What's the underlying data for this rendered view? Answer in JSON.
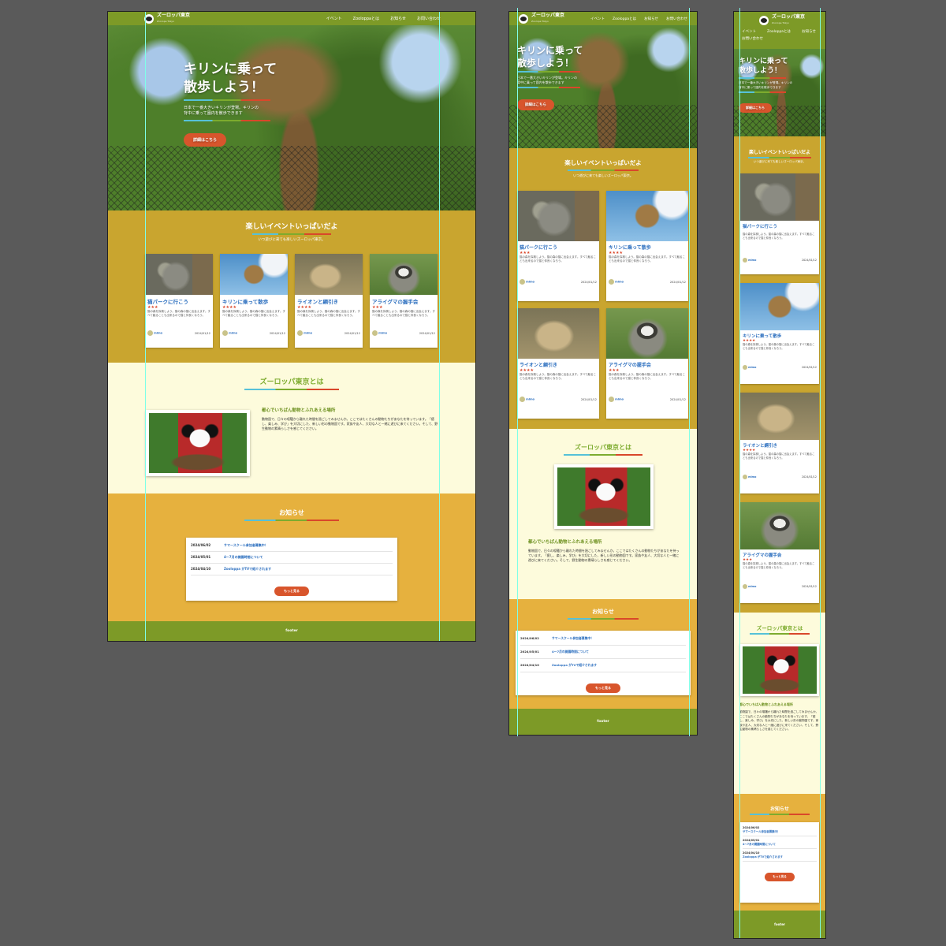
{
  "site": {
    "logo_text": "ズーロッパ東京",
    "logo_sub": "Zoorope Tokyo",
    "nav": [
      "イベント",
      "Zooloppaとは",
      "お知らせ",
      "お問い合わせ"
    ]
  },
  "hero": {
    "title_line1": "キリンに乗って",
    "title_line2": "散歩しよう！",
    "text_line1": "日本で一番大きいキリンが登場。キリンの",
    "text_line2": "背中に乗って園内を散歩できます",
    "button": "詳細はこちら"
  },
  "events": {
    "title": "楽しいイベントいっぱいだよ",
    "subtitle": "いつ遊びに来ても楽しいズーロッパ東京。",
    "cards": [
      {
        "title": "猫パークに行こう",
        "stars": "★★★",
        "rating": 3,
        "text": "猫の森を探検しよう。猫の森の猫に出会えます。すべて触ることも出来るので猫と仲良くなろう。",
        "author": "mimo",
        "date": "2024/01/12",
        "image": "wildcat"
      },
      {
        "title": "キリンに乗って散歩",
        "stars": "★★★★",
        "rating": 4,
        "text": "猫の森を探検しよう。猫の森の猫に出会えます。すべて触ることも出来るので猫と仲良くなろう。",
        "author": "mimo",
        "date": "2024/01/12",
        "image": "giraffe"
      },
      {
        "title": "ライオンと綱引き",
        "stars": "★★★★",
        "rating": 4,
        "text": "猫の森を探検しよう。猫の森の猫に出会えます。すべて触ることも出来るので猫と仲良くなろう。",
        "author": "mimo",
        "date": "2024/01/12",
        "image": "lion"
      },
      {
        "title": "アライグマの握手会",
        "stars": "★★★",
        "rating": 3,
        "text": "猫の森を探検しよう。猫の森の猫に出会えます。すべて触ることも出来るので猫と仲良くなろう。",
        "author": "mimo",
        "date": "2024/01/12",
        "image": "raccoon"
      }
    ]
  },
  "about": {
    "title": "ズーロッパ東京とは",
    "heading": "都心でいちばん動物とふれあえる場所",
    "body": "動物園で、日々の喧騒から離れた時間を過ごしてみませんか。ここではたくさんの動物たちがあなたを待っています。「癒し、楽しみ、学び」を大切にした、新しい形の動物園です。家族や友人、大切な人と一緒に遊びに来てください。そして、野生動物の素晴らしさを感じてください。"
  },
  "news": {
    "title": "お知らせ",
    "items": [
      {
        "date": "2024/06/02",
        "title": "サマースクール参加者募集中！"
      },
      {
        "date": "2024/05/01",
        "title": "4〜7月の開園時間について"
      },
      {
        "date": "2024/04/10",
        "title": "Zooloppa がTVで紹介されます"
      }
    ],
    "more_button": "もっと見る"
  },
  "footer": {
    "text": "footer"
  },
  "colors": {
    "header_green": "#7d9a27",
    "events_mustard": "#c9a52f",
    "about_cream": "#fdfbdc",
    "news_orange": "#e6b13e",
    "accent_red": "#d8552c",
    "link_blue": "#2c6fbf"
  }
}
